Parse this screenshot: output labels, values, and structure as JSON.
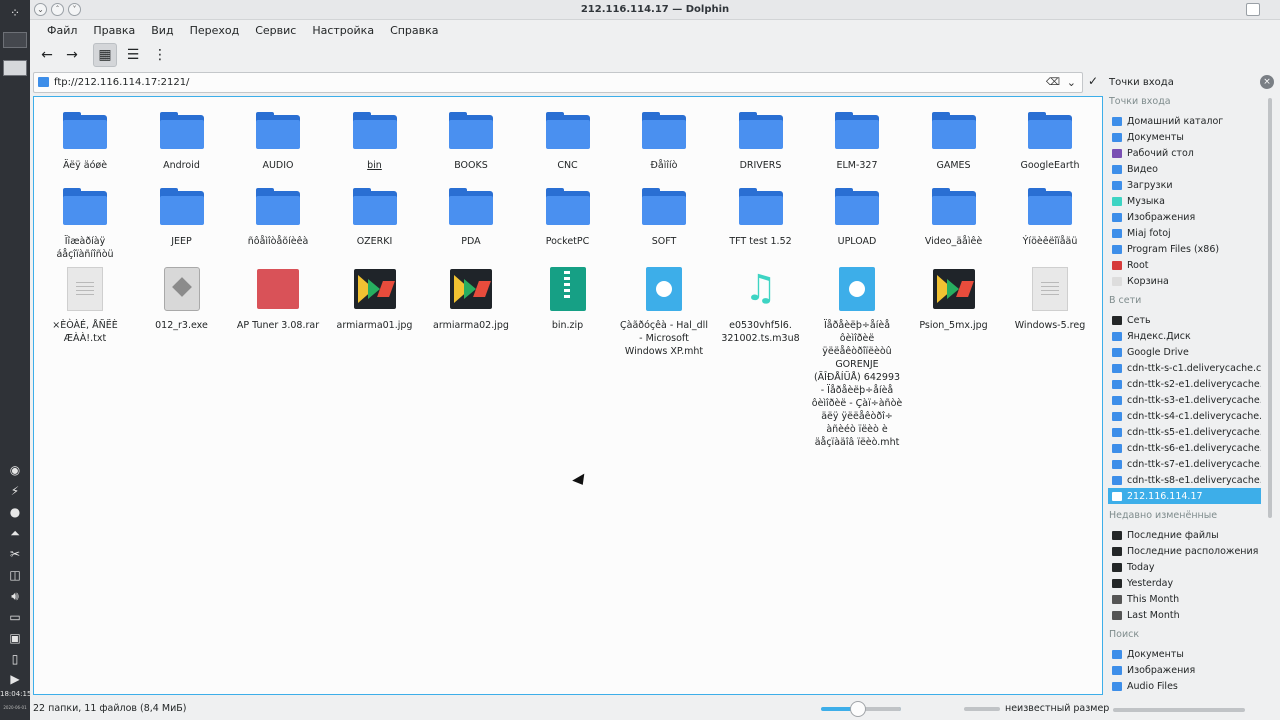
{
  "window": {
    "title": "212.116.114.17 — Dolphin"
  },
  "menu": [
    "Файл",
    "Правка",
    "Вид",
    "Переход",
    "Сервис",
    "Настройка",
    "Справка"
  ],
  "location": {
    "url": "ftp://212.116.114.17:2121/"
  },
  "folders": [
    "Äëÿ äóøè",
    "Android",
    "AUDIO",
    "bin",
    "BOOKS",
    "CNC",
    "Ðåìîíò",
    "DRIVERS",
    "ELM-327",
    "GAMES",
    "GoogleEarth",
    "Ïîæàðíàÿ áåçîïàñíîñòü",
    "JEEP",
    "ñôåìîòåõíèêà",
    "OZERKI",
    "PDA",
    "PocketPC",
    "SOFT",
    "TFT test 1.52",
    "UPLOAD",
    "Video_äåìêè",
    "Ýíöèêëîïåäü"
  ],
  "files": [
    {
      "name": "×ÈÒÀÉ, ÅÑËÈ ÆÀÀ!.txt",
      "icon": "text-file-icon"
    },
    {
      "name": "012_r3.exe",
      "icon": "executable-icon"
    },
    {
      "name": "AP Tuner 3.08.rar",
      "icon": "archive-icon"
    },
    {
      "name": "armiarma01.jpg",
      "icon": "image-icon"
    },
    {
      "name": "armiarma02.jpg",
      "icon": "image-icon"
    },
    {
      "name": "bin.zip",
      "icon": "zip-icon"
    },
    {
      "name": "Çàãðóçêà - Hal_dll - Microsoft Windows XP.mht",
      "icon": "web-file-icon"
    },
    {
      "name": "e0530vhf5l6. 321002.ts.m3u8",
      "icon": "music-icon"
    },
    {
      "name": "Ïåðåèëþ÷åíèå ôèìîðèë ÿëëåêòðîïëèòû GORENJE (ÃÎÐÅÍÜÅ) 642993 - Ïåðåèëþ÷åíèå ôèìîðèë - Çàï÷àñòè äëÿ ÿëëåêòðî÷ àñèéò ïëèò è äåçïàäîâ ïëèò.mht",
      "icon": "web-file-icon"
    },
    {
      "name": "Psion_5mx.jpg",
      "icon": "image-icon"
    },
    {
      "name": "Windows-5.reg",
      "icon": "text-file-icon"
    }
  ],
  "places": {
    "header": "Точки входа",
    "sections": [
      {
        "title": "Точки входа",
        "items": [
          {
            "label": "Домашний каталог",
            "color": "#3d8ee9"
          },
          {
            "label": "Документы",
            "color": "#3d8ee9"
          },
          {
            "label": "Рабочий стол",
            "color": "#7a4fb3"
          },
          {
            "label": "Видео",
            "color": "#3d8ee9"
          },
          {
            "label": "Загрузки",
            "color": "#3d8ee9"
          },
          {
            "label": "Музыка",
            "color": "#3dd4c3"
          },
          {
            "label": "Изображения",
            "color": "#3d8ee9"
          },
          {
            "label": "Miaj fotoj",
            "color": "#3d8ee9"
          },
          {
            "label": "Program Files (x86)",
            "color": "#3d8ee9"
          },
          {
            "label": "Root",
            "color": "#d63a3a"
          },
          {
            "label": "Корзина",
            "color": "#dddddd"
          }
        ]
      },
      {
        "title": "В сети",
        "items": [
          {
            "label": "Сеть",
            "color": "#232627"
          },
          {
            "label": "Яндекс.Диск",
            "color": "#3d8ee9"
          },
          {
            "label": "Google Drive",
            "color": "#3d8ee9"
          },
          {
            "label": "cdn-ttk-s-c1.deliverycache.co",
            "color": "#3d8ee9"
          },
          {
            "label": "cdn-ttk-s2-e1.deliverycache.co",
            "color": "#3d8ee9"
          },
          {
            "label": "cdn-ttk-s3-e1.deliverycache.co",
            "color": "#3d8ee9"
          },
          {
            "label": "cdn-ttk-s4-c1.deliverycache.co",
            "color": "#3d8ee9"
          },
          {
            "label": "cdn-ttk-s5-e1.deliverycache.co",
            "color": "#3d8ee9"
          },
          {
            "label": "cdn-ttk-s6-e1.deliverycache.co",
            "color": "#3d8ee9"
          },
          {
            "label": "cdn-ttk-s7-e1.deliverycache.co",
            "color": "#3d8ee9"
          },
          {
            "label": "cdn-ttk-s8-e1.deliverycache.co",
            "color": "#3d8ee9"
          },
          {
            "label": "212.116.114.17",
            "color": "#ffffff",
            "selected": true
          }
        ]
      },
      {
        "title": "Недавно изменённые",
        "items": [
          {
            "label": "Последние файлы",
            "color": "#232627"
          },
          {
            "label": "Последние расположения",
            "color": "#232627"
          },
          {
            "label": "Today",
            "color": "#232627"
          },
          {
            "label": "Yesterday",
            "color": "#232627"
          },
          {
            "label": "This Month",
            "color": "#555555"
          },
          {
            "label": "Last Month",
            "color": "#555555"
          }
        ]
      },
      {
        "title": "Поиск",
        "items": [
          {
            "label": "Документы",
            "color": "#3d8ee9"
          },
          {
            "label": "Изображения",
            "color": "#3d8ee9"
          },
          {
            "label": "Audio Files",
            "color": "#3d8ee9"
          }
        ]
      }
    ]
  },
  "status": {
    "summary": "22 папки, 11 файлов (8,4 МиБ)",
    "free_space": "неизвестный размер",
    "zoom_fraction": 0.45
  },
  "panel": {
    "clock": "18:04:15",
    "date": "2020-06-01"
  }
}
